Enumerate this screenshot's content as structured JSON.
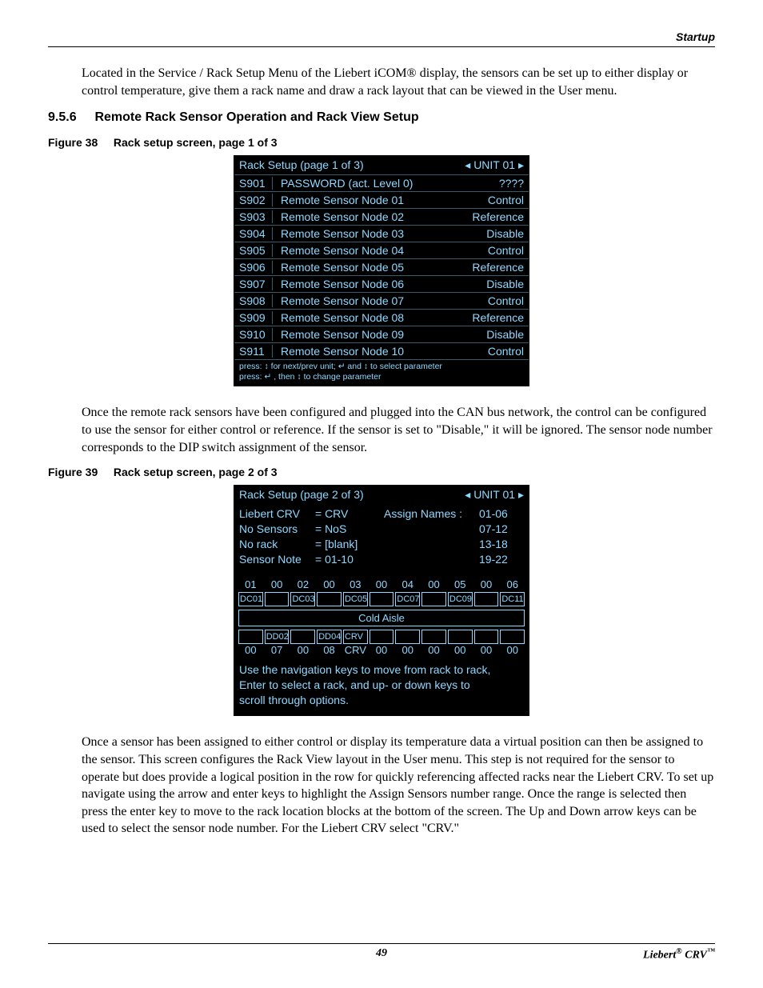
{
  "header": {
    "section": "Startup"
  },
  "paras": {
    "p1": "Located in the Service / Rack Setup Menu of the Liebert iCOM® display, the sensors can be set up to either display or control temperature, give them a rack name and draw a rack layout that can be viewed in the User menu.",
    "p2": "Once the remote rack sensors have been configured and plugged into the CAN bus network, the control can be configured to use the sensor for either control or reference. If the sensor is set to \"Disable,\" it will be ignored. The sensor node number corresponds to the DIP switch assignment of the sensor.",
    "p3": "Once a sensor has been assigned to either control or display its temperature data a virtual position can then be assigned to the sensor. This screen configures the Rack View layout in the User menu. This step is not required for the sensor to operate but does provide a logical position in the row for quickly referencing affected racks near the Liebert CRV. To set up navigate using the arrow and enter keys to highlight the Assign Sensors number range. Once the range is selected then press the enter key to move to the rack location blocks at the bottom of the screen. The Up and Down arrow keys can be used to select the sensor node number. For the Liebert CRV select \"CRV.\""
  },
  "section": {
    "number": "9.5.6",
    "title": "Remote Rack Sensor Operation and Rack View Setup"
  },
  "fig38": {
    "num": "Figure 38",
    "cap": "Rack setup screen, page 1 of 3"
  },
  "fig39": {
    "num": "Figure 39",
    "cap": "Rack setup screen, page 2 of 3"
  },
  "screen1": {
    "title_left": "Rack Setup   (page 1 of 3)",
    "title_right": "◂ UNIT 01 ▸",
    "rows": [
      {
        "code": "S901",
        "label": "PASSWORD (act. Level 0)",
        "val": "????"
      },
      {
        "code": "S902",
        "label": "Remote Sensor Node 01",
        "val": "Control"
      },
      {
        "code": "S903",
        "label": "Remote Sensor Node 02",
        "val": "Reference"
      },
      {
        "code": "S904",
        "label": "Remote Sensor Node 03",
        "val": "Disable"
      },
      {
        "code": "S905",
        "label": "Remote Sensor Node 04",
        "val": "Control"
      },
      {
        "code": "S906",
        "label": "Remote Sensor Node 05",
        "val": "Reference"
      },
      {
        "code": "S907",
        "label": "Remote Sensor Node 06",
        "val": "Disable"
      },
      {
        "code": "S908",
        "label": "Remote Sensor Node 07",
        "val": "Control"
      },
      {
        "code": "S909",
        "label": "Remote Sensor Node 08",
        "val": "Reference"
      },
      {
        "code": "S910",
        "label": "Remote Sensor Node 09",
        "val": "Disable"
      },
      {
        "code": "S911",
        "label": "Remote Sensor Node 10",
        "val": "Control"
      }
    ],
    "footer1": "press: ↕    for next/prev unit; ↵    and ↕ to select parameter",
    "footer2": "press: ↵    , then ↕    to change parameter"
  },
  "screen2": {
    "title_left": "Rack Setup   (page 2 of 3)",
    "title_right": "◂ UNIT 01 ▸",
    "top": {
      "col1": [
        "Liebert CRV",
        "No Sensors",
        "No rack",
        "Sensor Note"
      ],
      "col2": [
        "=  CRV",
        "=  NoS",
        "=  [blank]",
        "=  01-10"
      ],
      "assign_label": "Assign Names :",
      "assign_vals": [
        "01-06",
        "07-12",
        "13-18",
        "19-22"
      ]
    },
    "toprow_nums": [
      "01",
      "00",
      "02",
      "00",
      "03",
      "00",
      "04",
      "00",
      "05",
      "00",
      "06"
    ],
    "toprow_cells": [
      "DC01",
      "",
      "DC03",
      "",
      "DC05",
      "",
      "DC07",
      "",
      "DC09",
      "",
      "DC11"
    ],
    "cold_aisle": "Cold Aisle",
    "botrow_cells": [
      "",
      "DD02",
      "",
      "DD04",
      "CRV",
      "",
      "",
      "",
      "",
      "",
      ""
    ],
    "botrow_nums": [
      "00",
      "07",
      "00",
      "08",
      "CRV",
      "00",
      "00",
      "00",
      "00",
      "00",
      "00"
    ],
    "instr1": "Use the navigation keys to move from rack to rack,",
    "instr2": "Enter to select a rack, and up- or down keys to",
    "instr3": "scroll through options."
  },
  "footer": {
    "page": "49",
    "brand": "Liebert® CRV™"
  }
}
